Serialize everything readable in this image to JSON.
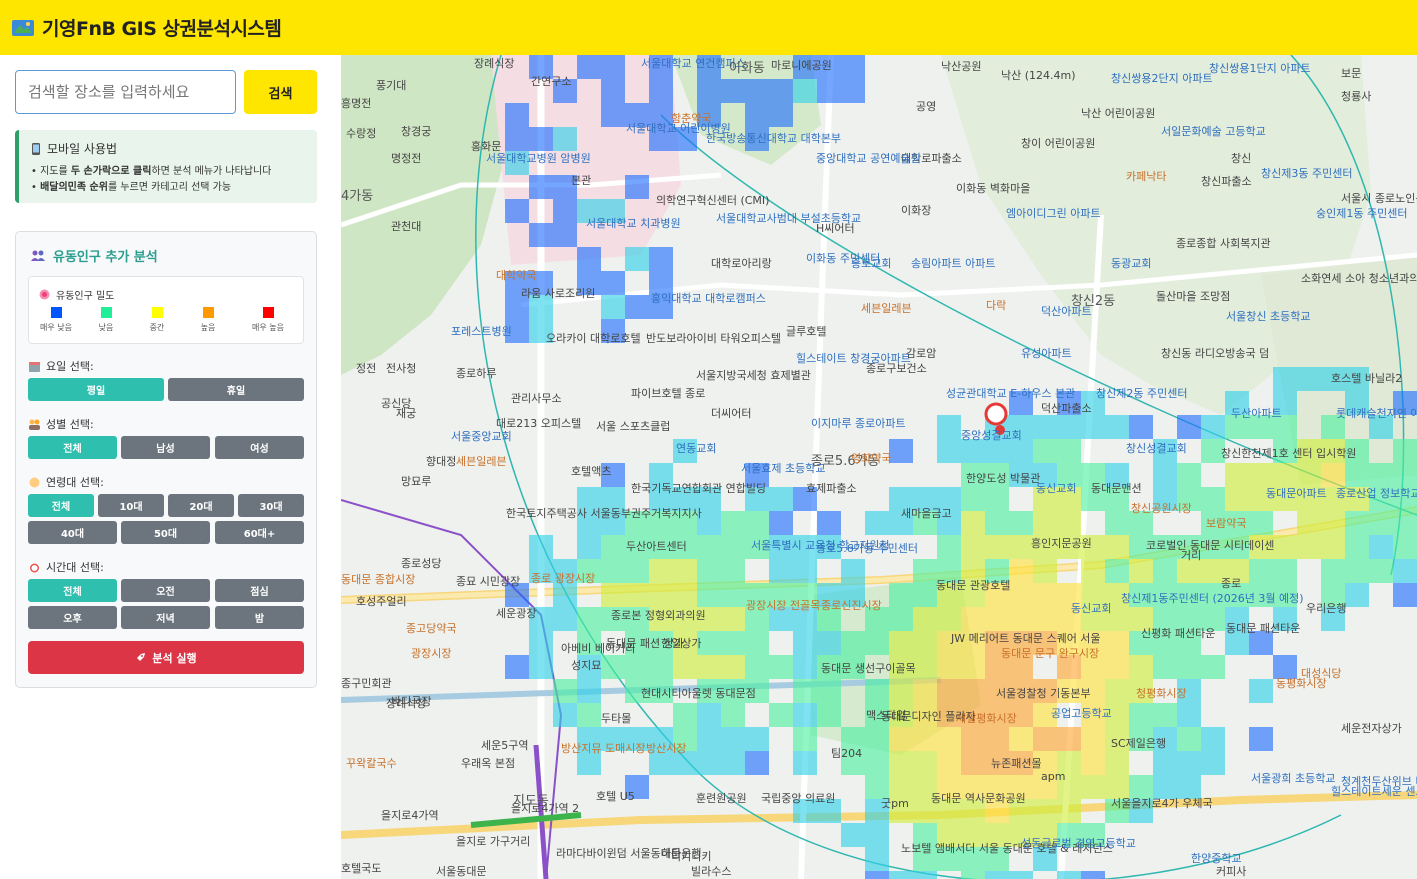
{
  "header": {
    "title": "기영FnB GIS 상권분석시스템",
    "logo_icon": "map-icon",
    "bg_color": "#ffe600"
  },
  "search": {
    "placeholder": "검색할 장소를 입력하세요",
    "button_label": "검색"
  },
  "mobile_tip": {
    "title": "모바일 사용법",
    "line1_pre": "• 지도를 ",
    "line1_bold": "두 손가락으로 클릭",
    "line1_post": "하면 분석 메뉴가 나타납니다",
    "line2_pre": "• ",
    "line2_bold": "배달의민족 순위",
    "line2_post": "를 누르면 카테고리 선택 가능"
  },
  "analysis": {
    "title": "유동인구 추가 분석",
    "legend_title": "유동인구 밀도",
    "legend": [
      {
        "label": "매우 낮음",
        "color": "#0055ff"
      },
      {
        "label": "낮음",
        "color": "#22ee99"
      },
      {
        "label": "중간",
        "color": "#ffff00"
      },
      {
        "label": "높음",
        "color": "#ff9900"
      },
      {
        "label": "매우 높음",
        "color": "#ff0000"
      }
    ],
    "day": {
      "label": "요일 선택:",
      "options": [
        "평일",
        "휴일"
      ]
    },
    "gender": {
      "label": "성별 선택:",
      "options": [
        "전체",
        "남성",
        "여성"
      ]
    },
    "age": {
      "label": "연령대 선택:",
      "options": [
        "전체",
        "10대",
        "20대",
        "30대",
        "40대",
        "50대",
        "60대+"
      ]
    },
    "time": {
      "label": "시간대 선택:",
      "options": [
        "전체",
        "오전",
        "점심",
        "오후",
        "저녁",
        "밤"
      ]
    },
    "run_label": "분석 실행",
    "active_color": "#2ebfae",
    "run_color": "#dc3545"
  },
  "map": {
    "labels": [
      "장례식장",
      "간연구소",
      "서울대학교 연건캠퍼스",
      "이화동",
      "마로니에공원",
      "낙산공원",
      "낙산 (124.4m)",
      "창신쌍용2단지 아파트",
      "창신쌍용1단지 아파트",
      "보문",
      "청룡사",
      "풍기대",
      "흥명전",
      "수랑정",
      "창경궁",
      "명정전",
      "홍화문",
      "함춘약국",
      "한국방송통신대학교 대학본부",
      "공영",
      "서울대학교 어린이병원",
      "서울대학교병원 암병원",
      "본관",
      "낙산 어린이공원",
      "창이 어린이공원",
      "서일문화예술 고등학교",
      "창신",
      "창신제3동 주민센터",
      "대학로파출소",
      "중앙대학교 공연예술원",
      "이화동 벽화마을",
      "이화장",
      "카페낙타",
      "창신파출소",
      "숭인제1동 주민센터",
      "서울시 종로노인복지",
      "4가동",
      "관천대",
      "의학연구혁신센터 (CMI)",
      "서울대학교 치과병원",
      "서울대학교사범대 부설초등학교",
      "H씨어터",
      "엠아이디그린 아파트",
      "동광교회",
      "종로종합 사회복지관",
      "대학약국",
      "대학로아리랑",
      "이화동 주민센터",
      "종로교회",
      "송림아파트 아파트",
      "라움 사로조리원",
      "홍익대학교 대학로캠퍼스",
      "세븐일레븐",
      "다락",
      "창신2동",
      "덕산아파트",
      "돌산마을 조망점",
      "서울창신 초등학교",
      "소화연세 소아 청소년과의원",
      "포레스트병원",
      "오라카이 대학로호텔",
      "반도보라아이비 타워오피스텔",
      "글루호텔",
      "감로암",
      "유성아파트",
      "창신동 라디오방송국 덤",
      "호스텔 바닐라2",
      "종로구보건소",
      "정전",
      "전사청",
      "종로하루",
      "서울지방국세청 효제별관",
      "힐스테이트 창경궁아파트",
      "성균관대학교 E-하우스 본관",
      "덕산파출소",
      "창신제2동 주민센터",
      "두산아파트",
      "롯데캐슬천지인 아파트",
      "공신당",
      "재궁",
      "관리사무소",
      "파이브호텔 종로",
      "더씨어터",
      "이지마루 종로아파트",
      "중앙성결교회",
      "창신성결교회",
      "창신한천제1호 센터 입시학원",
      "대로213 오피스텔",
      "서울중앙교회",
      "서울 스포츠클럽",
      "연동교회",
      "종로5.6가동",
      "영화약국",
      "향대정",
      "세븐일레븐",
      "망묘루",
      "호텔액츠",
      "서울효제 초등학교",
      "한양도성 박물관",
      "동신교회",
      "동대문맨션",
      "한국기독교연합회관 연합빌딩",
      "효제파출소",
      "새마을금고",
      "창신공원시장",
      "보람약국",
      "동대문아파트",
      "종로산업 정보학교",
      "한국토지주택공사 서울동부권주거복지지사",
      "두산아트센터",
      "서울특별시 교육청 학교지원청",
      "흥인지문공원",
      "코로벌인 동대문 시티데이센",
      "거리",
      "종로5.6가동 주민센터",
      "종로성당",
      "종묘 시민광장",
      "동대문 종합시장",
      "동대문 관광호텔",
      "동대문 문구 완구시장",
      "종로",
      "호성주얼리",
      "종로 광장시장",
      "종로신진시장",
      "동신교회",
      "창신제1동주민센터 (2026년 3월 예정)",
      "우리은행",
      "세운광장",
      "종고당약국",
      "광장시장 전골목",
      "종로본 정형외과의원",
      "한일상가",
      "동대문 생선구이골목",
      "JW 메리어트 동대문 스퀘어 서울",
      "동대문 패션타운",
      "동대문 패션 상가",
      "신평화 패션타운",
      "동평화시장",
      "청평화시장",
      "대성식당",
      "광장시장",
      "바디국장",
      "아베비 베이커리",
      "성지묘",
      "현대시티아울렛 동대문점",
      "두타몰",
      "맥스타일",
      "제일평화시장",
      "서울경찰청 기동본부",
      "공업고등학교",
      "SC제일은행",
      "세운전자상가",
      "종구민회관",
      "장례식장",
      "동대문디자인 플라자",
      "팀204",
      "apm",
      "서울광희 초등학교",
      "청계천두산위브 더제니스아파트",
      "힐스테이트세운 센트럴2단지아파트",
      "꾸왁칼국수",
      "세운5구역",
      "우래옥 본점",
      "방산지뮤 도매시장",
      "방산시장",
      "호텔 U5",
      "훈련원공원",
      "국립중앙 의료원",
      "굿pm",
      "동대문 역사문화공원",
      "뉴존패션몰",
      "서울을지로4가 우체국",
      "을지로4가역",
      "을지로4가역 2",
      "지도동",
      "을지로 가구거리",
      "라마다바이윈덤 서울동대문",
      "하다은행",
      "노보텔 앰배서더 서울 동대문 호텔 & 레지던스",
      "디키디키",
      "성동글로벌 경영고등학교",
      "한양중학교",
      "커피사",
      "호텔국도",
      "서울동대문",
      "빌라수스"
    ]
  }
}
